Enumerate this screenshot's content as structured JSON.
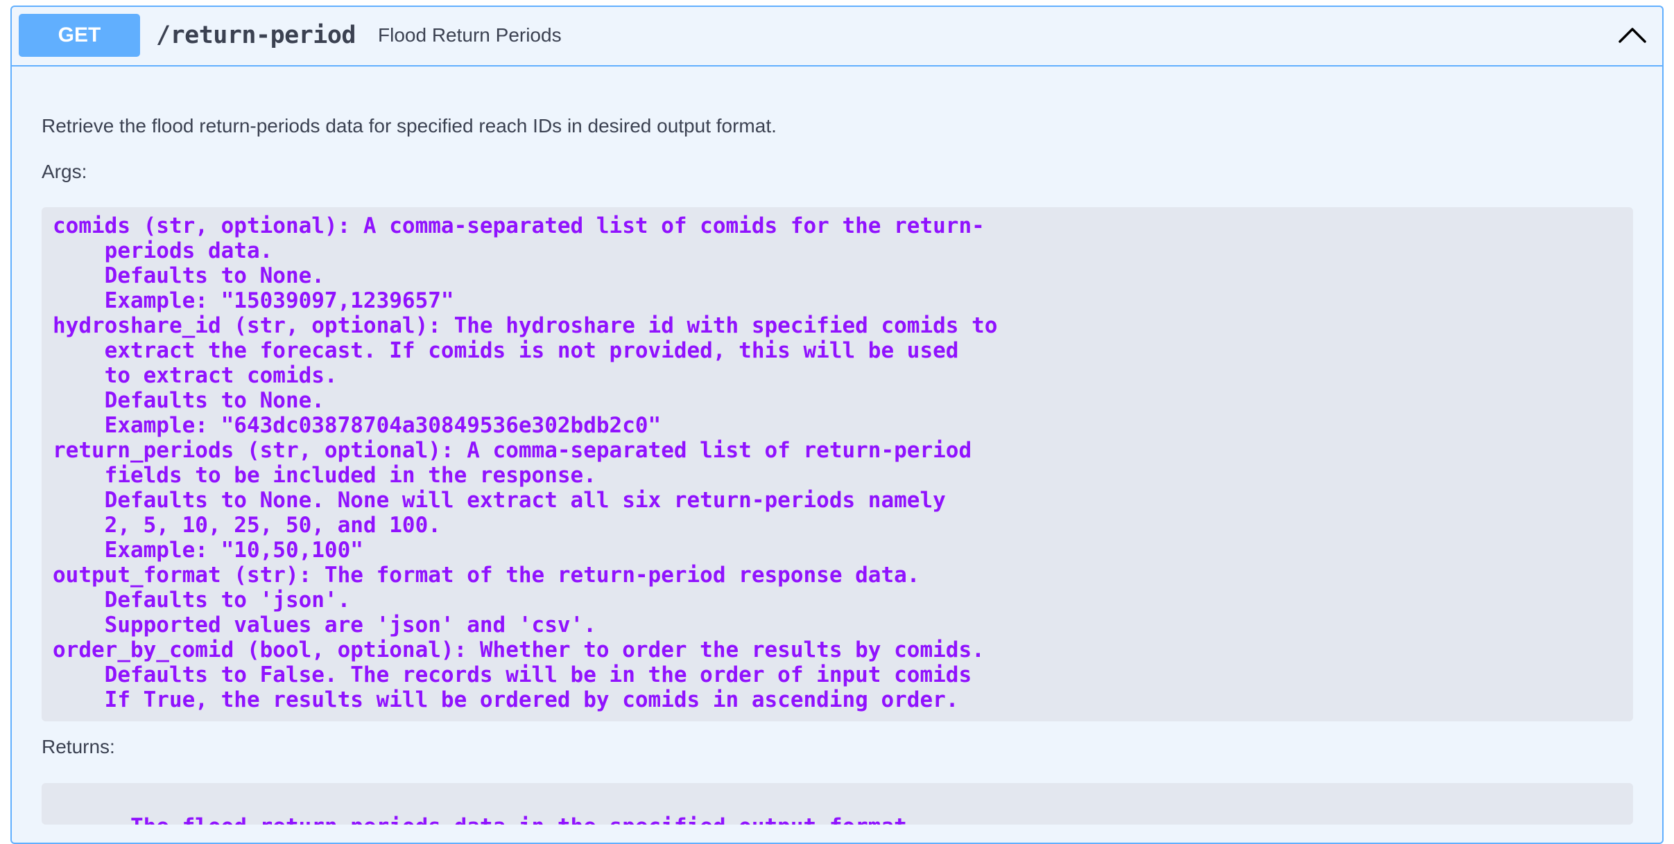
{
  "operation": {
    "method": "GET",
    "path": "/return-period",
    "summary": "Flood Return Periods",
    "collapse_icon": "chevron-up-icon"
  },
  "description": {
    "intro": "Retrieve the flood return-periods data for specified reach IDs in desired output format.",
    "args_label": "Args:",
    "args_lines": [
      "comids (str, optional): A comma-separated list of comids for the return-",
      "    periods data.",
      "    Defaults to None.",
      "    Example: \"15039097,1239657\"",
      "hydroshare_id (str, optional): The hydroshare id with specified comids to",
      "    extract the forecast. If comids is not provided, this will be used",
      "    to extract comids.",
      "    Defaults to None.",
      "    Example: \"643dc03878704a30849536e302bdb2c0\"",
      "return_periods (str, optional): A comma-separated list of return-period",
      "    fields to be included in the response.",
      "    Defaults to None. None will extract all six return-periods namely",
      "    2, 5, 10, 25, 50, and 100.",
      "    Example: \"10,50,100\"",
      "output_format (str): The format of the return-period response data.",
      "    Defaults to 'json'.",
      "    Supported values are 'json' and 'csv'.",
      "order_by_comid (bool, optional): Whether to order the results by comids.",
      "    Defaults to False. The records will be in the order of input comids",
      "    If True, the results will be ordered by comids in ascending order."
    ],
    "returns_label": "Returns:",
    "returns_text": "The flood return periods data in the specified output format."
  },
  "colors": {
    "get_accent": "#61affe",
    "code_text": "#9012fe",
    "code_bg": "#e3e7ef",
    "block_bg": "#eef5fd"
  }
}
